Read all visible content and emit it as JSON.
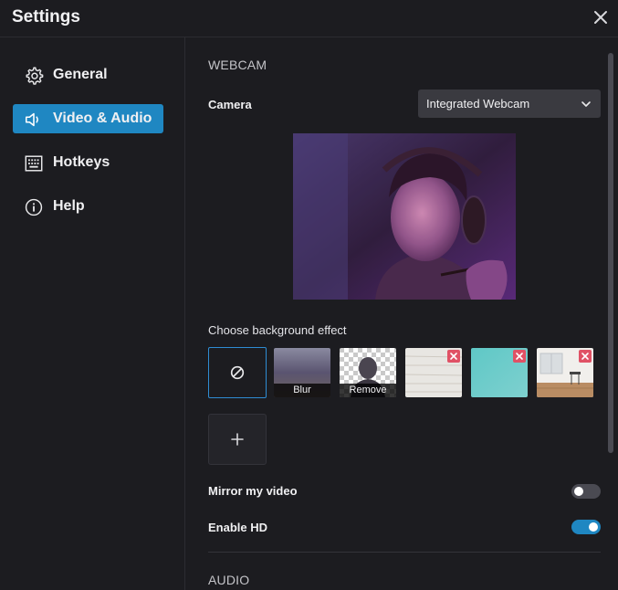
{
  "window": {
    "title": "Settings"
  },
  "sidebar": {
    "items": [
      {
        "label": "General",
        "icon": "gear-icon",
        "active": false
      },
      {
        "label": "Video & Audio",
        "icon": "speaker-icon",
        "active": true
      },
      {
        "label": "Hotkeys",
        "icon": "keyboard-icon",
        "active": false
      },
      {
        "label": "Help",
        "icon": "info-icon",
        "active": false
      }
    ]
  },
  "webcam": {
    "section_title": "WEBCAM",
    "camera_label": "Camera",
    "camera_value": "Integrated Webcam",
    "preview_icon": "webcam-preview-image",
    "background_label": "Choose background effect",
    "effects": [
      {
        "caption": "",
        "icon": "none-icon"
      },
      {
        "caption": "Blur"
      },
      {
        "caption": "Remove"
      },
      {
        "caption": ""
      },
      {
        "caption": ""
      },
      {
        "caption": ""
      }
    ],
    "add_icon": "plus-icon"
  },
  "toggles": {
    "mirror_label": "Mirror my video",
    "mirror_on": false,
    "hd_label": "Enable HD",
    "hd_on": true
  },
  "audio": {
    "section_title": "AUDIO"
  },
  "colors": {
    "accent": "#1f87c2",
    "background": "#1c1c20",
    "remove_badge": "#e05165"
  }
}
